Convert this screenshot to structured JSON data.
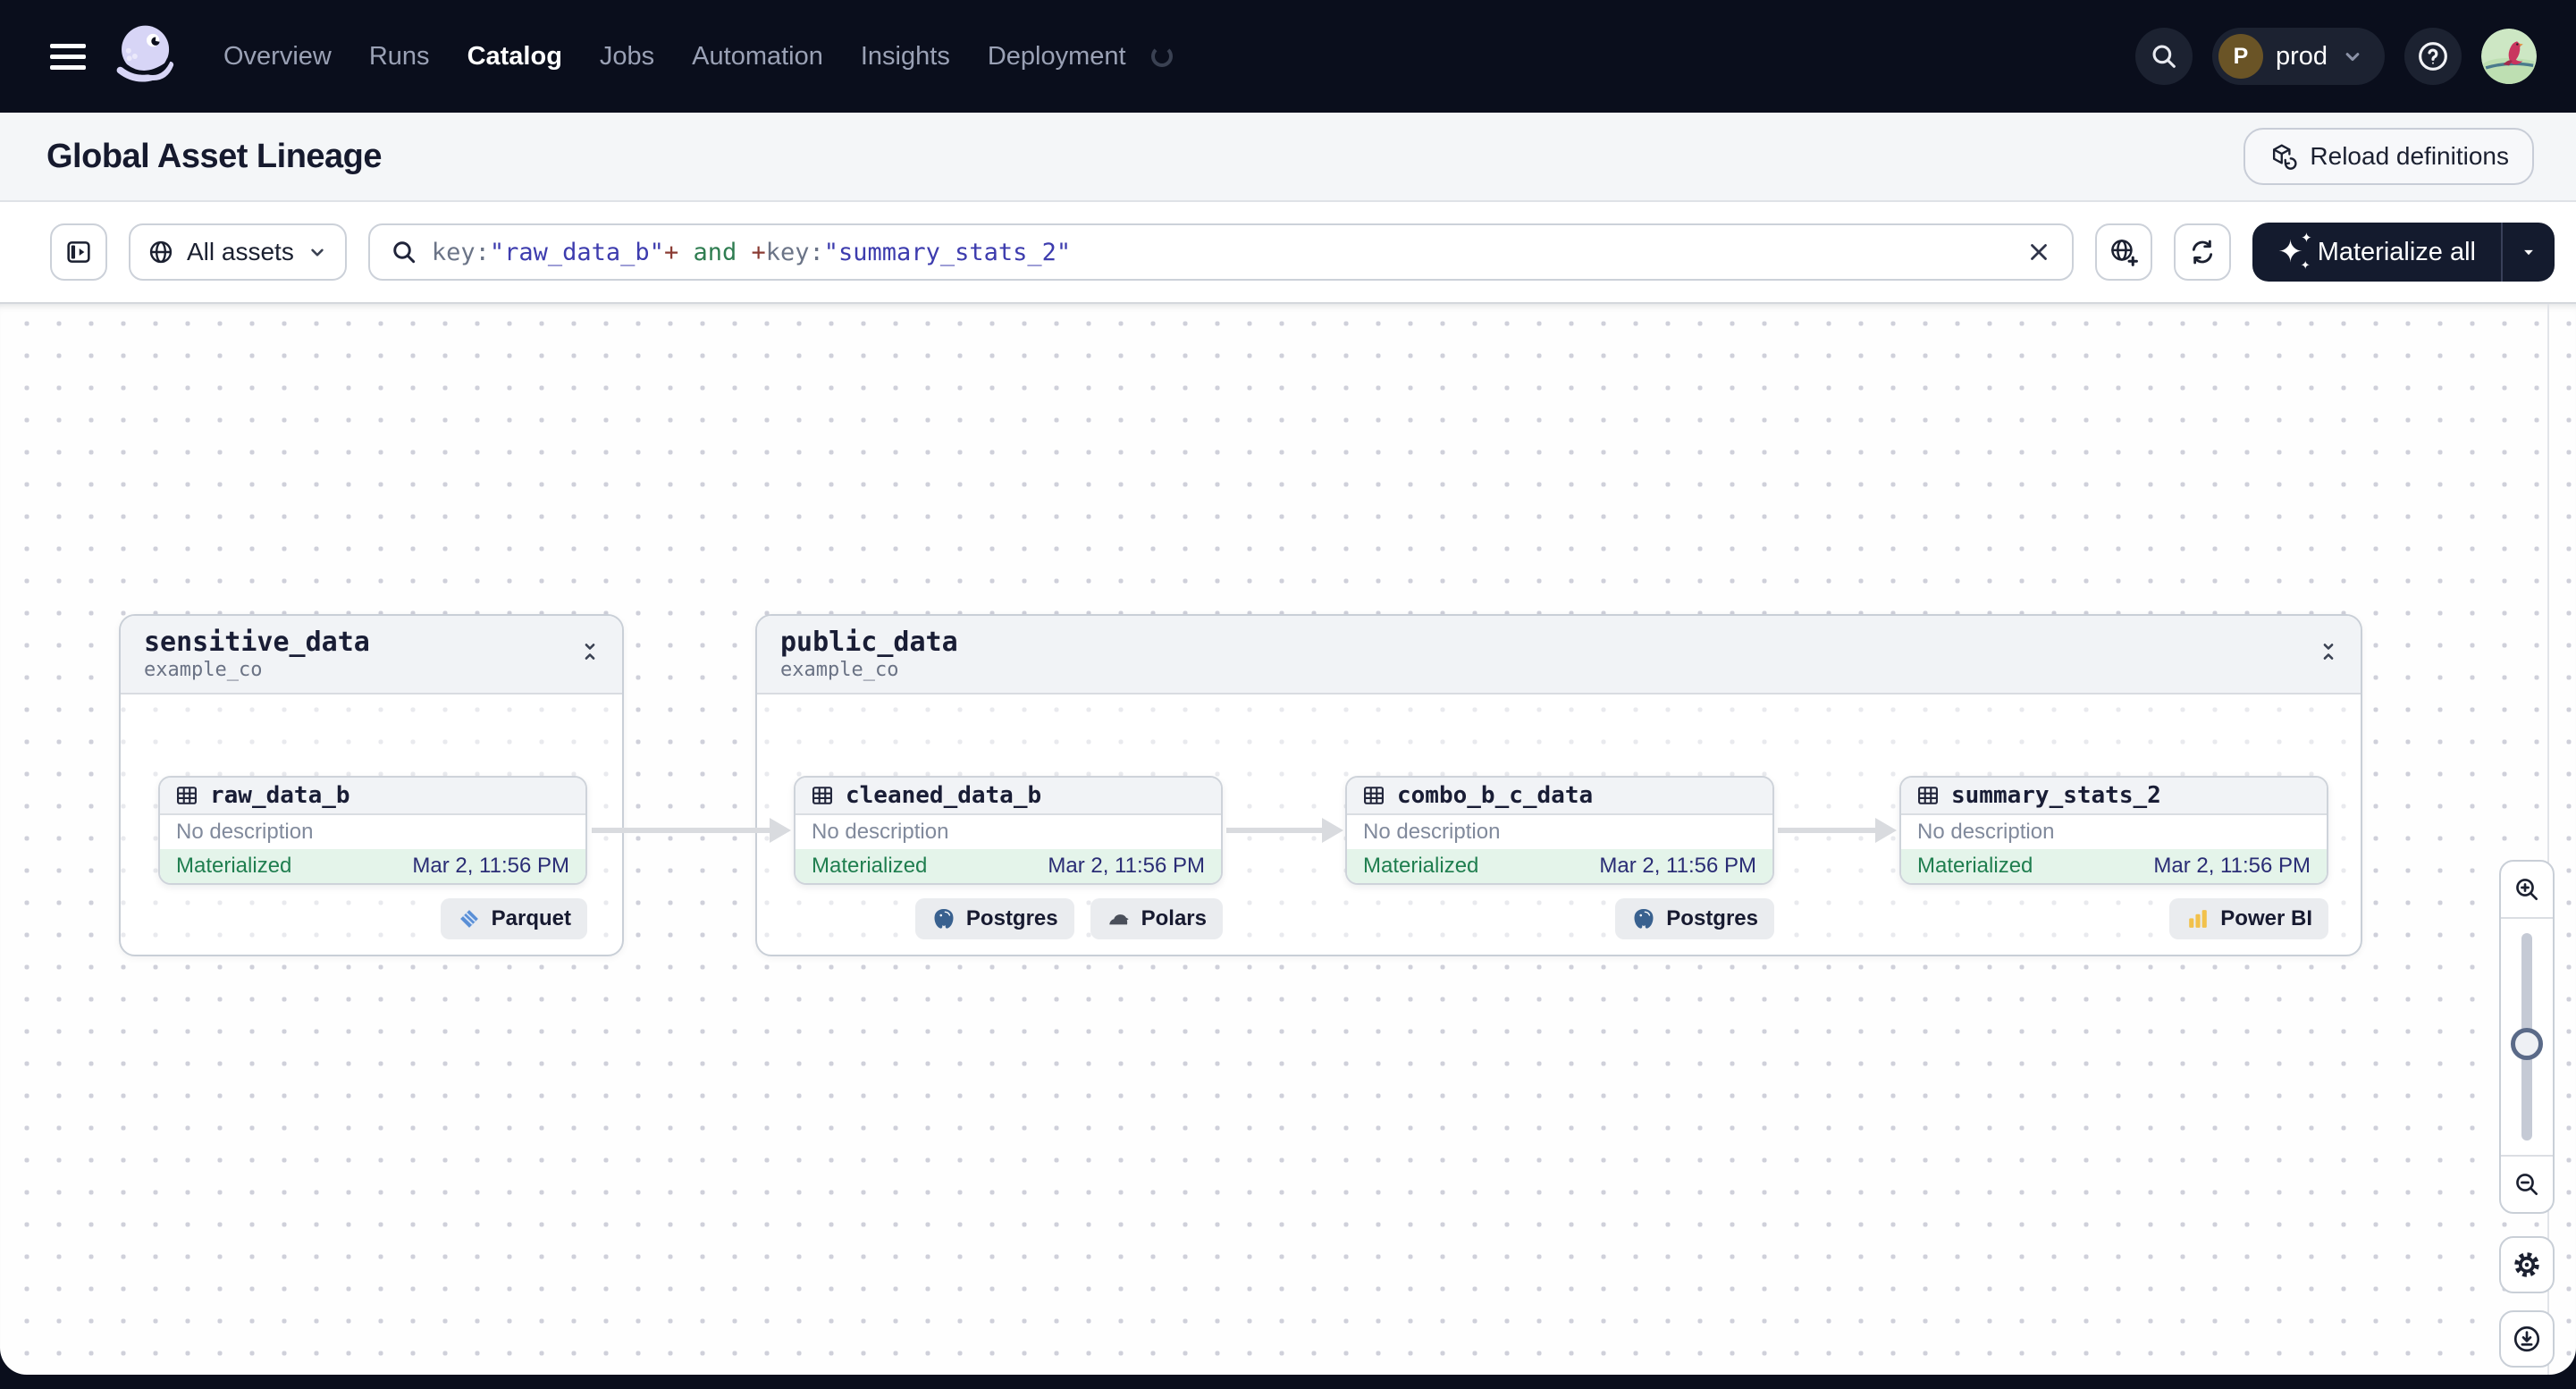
{
  "topbar": {
    "nav": [
      {
        "label": "Overview",
        "active": false
      },
      {
        "label": "Runs",
        "active": false
      },
      {
        "label": "Catalog",
        "active": true
      },
      {
        "label": "Jobs",
        "active": false
      },
      {
        "label": "Automation",
        "active": false
      },
      {
        "label": "Insights",
        "active": false
      },
      {
        "label": "Deployment",
        "active": false
      }
    ],
    "deployment": {
      "initial": "P",
      "name": "prod"
    }
  },
  "page_header": {
    "title": "Global Asset Lineage",
    "reload_button_label": "Reload definitions"
  },
  "toolbar": {
    "scope_button_label": "All assets",
    "query": {
      "segments": [
        {
          "kind": "key",
          "text": "key:"
        },
        {
          "kind": "string",
          "text": "\"raw_data_b\""
        },
        {
          "kind": "operator",
          "text": "+"
        },
        {
          "kind": "keyword",
          "text": " and "
        },
        {
          "kind": "operator",
          "text": "+"
        },
        {
          "kind": "key",
          "text": "key:"
        },
        {
          "kind": "string",
          "text": "\"summary_stats_2\""
        }
      ]
    },
    "materialize_button_label": "Materialize all"
  },
  "graph": {
    "groups": [
      {
        "name": "sensitive_data",
        "location": "example_co"
      },
      {
        "name": "public_data",
        "location": "example_co"
      }
    ],
    "nodes": [
      {
        "name": "raw_data_b",
        "description": "No description",
        "status": "Materialized",
        "materialized_at": "Mar 2, 11:56 PM",
        "badges": [
          {
            "label": "Parquet",
            "icon": "parquet"
          }
        ]
      },
      {
        "name": "cleaned_data_b",
        "description": "No description",
        "status": "Materialized",
        "materialized_at": "Mar 2, 11:56 PM",
        "badges": [
          {
            "label": "Postgres",
            "icon": "postgres"
          },
          {
            "label": "Polars",
            "icon": "polars"
          }
        ]
      },
      {
        "name": "combo_b_c_data",
        "description": "No description",
        "status": "Materialized",
        "materialized_at": "Mar 2, 11:56 PM",
        "badges": [
          {
            "label": "Postgres",
            "icon": "postgres"
          }
        ]
      },
      {
        "name": "summary_stats_2",
        "description": "No description",
        "status": "Materialized",
        "materialized_at": "Mar 2, 11:56 PM",
        "badges": [
          {
            "label": "Power BI",
            "icon": "powerbi"
          }
        ]
      }
    ]
  },
  "colors": {
    "topbar_bg": "#0a0e1c",
    "accent_dark_button": "#141b2e",
    "status_materialized_green": "#1f7e4f",
    "timestamp_indigo": "#2a2d75",
    "query_string": "#3d3cae",
    "query_keyword": "#2f7d51",
    "query_operator": "#8a3b33"
  }
}
